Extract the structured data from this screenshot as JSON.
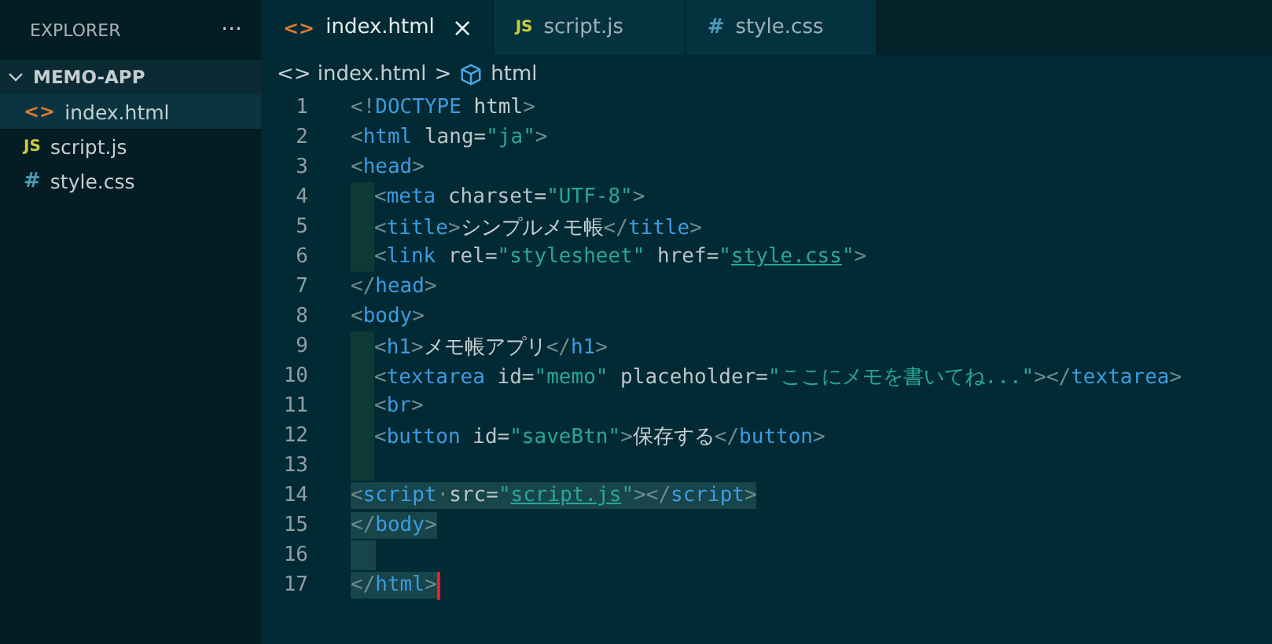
{
  "sidebar": {
    "title": "EXPLORER",
    "more": "···",
    "folder": {
      "name": "MEMO-APP",
      "expanded": true,
      "files": [
        {
          "name": "index.html",
          "kind": "html",
          "icon": "<>",
          "selected": true
        },
        {
          "name": "script.js",
          "kind": "js",
          "icon": "JS",
          "selected": false
        },
        {
          "name": "style.css",
          "kind": "css",
          "icon": "#",
          "selected": false
        }
      ]
    }
  },
  "tabs": [
    {
      "label": "index.html",
      "kind": "html",
      "icon": "<>",
      "selected": true,
      "close": "×"
    },
    {
      "label": "script.js",
      "kind": "js",
      "icon": "JS",
      "selected": false
    },
    {
      "label": "style.css",
      "kind": "css",
      "icon": "#",
      "selected": false
    }
  ],
  "breadcrumb": {
    "file": "index.html",
    "file_icon": "<>",
    "separator": ">",
    "symbol": "html"
  },
  "lines": [
    {
      "number": "1",
      "indented": false,
      "selected": false,
      "tokens": [
        {
          "kind": "punct",
          "text": "<!"
        },
        {
          "kind": "tag",
          "text": "DOCTYPE"
        },
        {
          "kind": "text",
          "text": " html"
        },
        {
          "kind": "punct",
          "text": ">"
        }
      ]
    },
    {
      "number": "2",
      "indented": false,
      "selected": false,
      "tokens": [
        {
          "kind": "punct",
          "text": "<"
        },
        {
          "kind": "tag",
          "text": "html"
        },
        {
          "kind": "attr",
          "text": " lang="
        },
        {
          "kind": "string",
          "text": "\"ja\""
        },
        {
          "kind": "punct",
          "text": ">"
        }
      ]
    },
    {
      "number": "3",
      "indented": false,
      "selected": false,
      "tokens": [
        {
          "kind": "punct",
          "text": "<"
        },
        {
          "kind": "tag",
          "text": "head"
        },
        {
          "kind": "punct",
          "text": ">"
        }
      ]
    },
    {
      "number": "4",
      "indented": true,
      "selected": false,
      "tokens": [
        {
          "kind": "punct",
          "text": "<"
        },
        {
          "kind": "tag",
          "text": "meta"
        },
        {
          "kind": "attr",
          "text": " charset="
        },
        {
          "kind": "string",
          "text": "\"UTF-8\""
        },
        {
          "kind": "punct",
          "text": ">"
        }
      ]
    },
    {
      "number": "5",
      "indented": true,
      "selected": false,
      "tokens": [
        {
          "kind": "punct",
          "text": "<"
        },
        {
          "kind": "tag",
          "text": "title"
        },
        {
          "kind": "punct",
          "text": ">"
        },
        {
          "kind": "text",
          "text": "シンプルメモ帳"
        },
        {
          "kind": "punct",
          "text": "</"
        },
        {
          "kind": "tag",
          "text": "title"
        },
        {
          "kind": "punct",
          "text": ">"
        }
      ]
    },
    {
      "number": "6",
      "indented": true,
      "selected": false,
      "tokens": [
        {
          "kind": "punct",
          "text": "<"
        },
        {
          "kind": "tag",
          "text": "link"
        },
        {
          "kind": "attr",
          "text": " rel="
        },
        {
          "kind": "string",
          "text": "\"stylesheet\""
        },
        {
          "kind": "attr",
          "text": " href="
        },
        {
          "kind": "string",
          "text": "\""
        },
        {
          "kind": "link",
          "text": "style.css"
        },
        {
          "kind": "string",
          "text": "\""
        },
        {
          "kind": "punct",
          "text": ">"
        }
      ]
    },
    {
      "number": "7",
      "indented": false,
      "selected": false,
      "tokens": [
        {
          "kind": "punct",
          "text": "</"
        },
        {
          "kind": "tag",
          "text": "head"
        },
        {
          "kind": "punct",
          "text": ">"
        }
      ]
    },
    {
      "number": "8",
      "indented": false,
      "selected": false,
      "tokens": [
        {
          "kind": "punct",
          "text": "<"
        },
        {
          "kind": "tag",
          "text": "body"
        },
        {
          "kind": "punct",
          "text": ">"
        }
      ]
    },
    {
      "number": "9",
      "indented": true,
      "selected": false,
      "tokens": [
        {
          "kind": "punct",
          "text": "<"
        },
        {
          "kind": "tag",
          "text": "h1"
        },
        {
          "kind": "punct",
          "text": ">"
        },
        {
          "kind": "text",
          "text": "メモ帳アプリ"
        },
        {
          "kind": "punct",
          "text": "</"
        },
        {
          "kind": "tag",
          "text": "h1"
        },
        {
          "kind": "punct",
          "text": ">"
        }
      ]
    },
    {
      "number": "10",
      "indented": true,
      "selected": false,
      "tokens": [
        {
          "kind": "punct",
          "text": "<"
        },
        {
          "kind": "tag",
          "text": "textarea"
        },
        {
          "kind": "attr",
          "text": " id="
        },
        {
          "kind": "string",
          "text": "\"memo\""
        },
        {
          "kind": "attr",
          "text": " placeholder="
        },
        {
          "kind": "string",
          "text": "\"ここにメモを書いてね...\""
        },
        {
          "kind": "punct",
          "text": "></"
        },
        {
          "kind": "tag",
          "text": "textarea"
        },
        {
          "kind": "punct",
          "text": ">"
        }
      ]
    },
    {
      "number": "11",
      "indented": true,
      "selected": false,
      "tokens": [
        {
          "kind": "punct",
          "text": "<"
        },
        {
          "kind": "tag",
          "text": "br"
        },
        {
          "kind": "punct",
          "text": ">"
        }
      ]
    },
    {
      "number": "12",
      "indented": true,
      "selected": false,
      "tokens": [
        {
          "kind": "punct",
          "text": "<"
        },
        {
          "kind": "tag",
          "text": "button"
        },
        {
          "kind": "attr",
          "text": " id="
        },
        {
          "kind": "string",
          "text": "\"saveBtn\""
        },
        {
          "kind": "punct",
          "text": ">"
        },
        {
          "kind": "text",
          "text": "保存する"
        },
        {
          "kind": "punct",
          "text": "</"
        },
        {
          "kind": "tag",
          "text": "button"
        },
        {
          "kind": "punct",
          "text": ">"
        }
      ]
    },
    {
      "number": "13",
      "indented": true,
      "selected": false
    },
    {
      "number": "14",
      "indented": false,
      "selected": true,
      "tokens": [
        {
          "kind": "punct",
          "text": "<"
        },
        {
          "kind": "tag",
          "text": "script"
        },
        {
          "kind": "punct",
          "text": "·"
        },
        {
          "kind": "attr",
          "text": "src="
        },
        {
          "kind": "string",
          "text": "\""
        },
        {
          "kind": "link",
          "text": "script.js"
        },
        {
          "kind": "string",
          "text": "\""
        },
        {
          "kind": "punct",
          "text": "></"
        },
        {
          "kind": "tag",
          "text": "script"
        },
        {
          "kind": "punct",
          "text": ">"
        }
      ]
    },
    {
      "number": "15",
      "indented": false,
      "selected": true,
      "tokens": [
        {
          "kind": "punct",
          "text": "</"
        },
        {
          "kind": "tag",
          "text": "body"
        },
        {
          "kind": "punct",
          "text": ">"
        }
      ]
    },
    {
      "number": "16",
      "indented": false,
      "selected": true
    },
    {
      "number": "17",
      "indented": false,
      "selected": true,
      "cursor": true,
      "tokens": [
        {
          "kind": "punct",
          "text": "</"
        },
        {
          "kind": "tag",
          "text": "html"
        },
        {
          "kind": "punct",
          "text": ">"
        }
      ]
    }
  ]
}
